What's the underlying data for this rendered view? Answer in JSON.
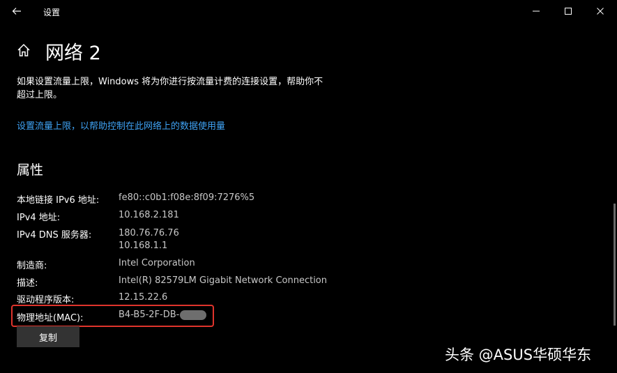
{
  "window": {
    "title": "设置"
  },
  "page": {
    "title": "网络 2",
    "description": "如果设置流量上限，Windows 将为你进行按流量计费的连接设置，帮助你不超过上限。",
    "link_text": "设置流量上限，以帮助控制在此网络上的数据使用量"
  },
  "properties": {
    "section_title": "属性",
    "rows": [
      {
        "label": "本地链接 IPv6 地址:",
        "value": "fe80::c0b1:f08e:8f09:7276%5"
      },
      {
        "label": "IPv4 地址:",
        "value": "10.168.2.181"
      },
      {
        "label": "IPv4 DNS 服务器:",
        "value": "180.76.76.76",
        "value2": "10.168.1.1"
      },
      {
        "label": "制造商:",
        "value": "Intel Corporation"
      },
      {
        "label": "描述:",
        "value": "Intel(R) 82579LM Gigabit Network Connection"
      },
      {
        "label": "驱动程序版本:",
        "value": "12.15.22.6"
      },
      {
        "label": "物理地址(MAC):",
        "value": "B4-B5-2F-DB-"
      }
    ],
    "copy_button": "复制"
  },
  "watermark": "头条 @ASUS华硕华东",
  "colors": {
    "background": "#000000",
    "link": "#3fa3f5",
    "highlight": "#e0342c",
    "button": "#333333"
  }
}
